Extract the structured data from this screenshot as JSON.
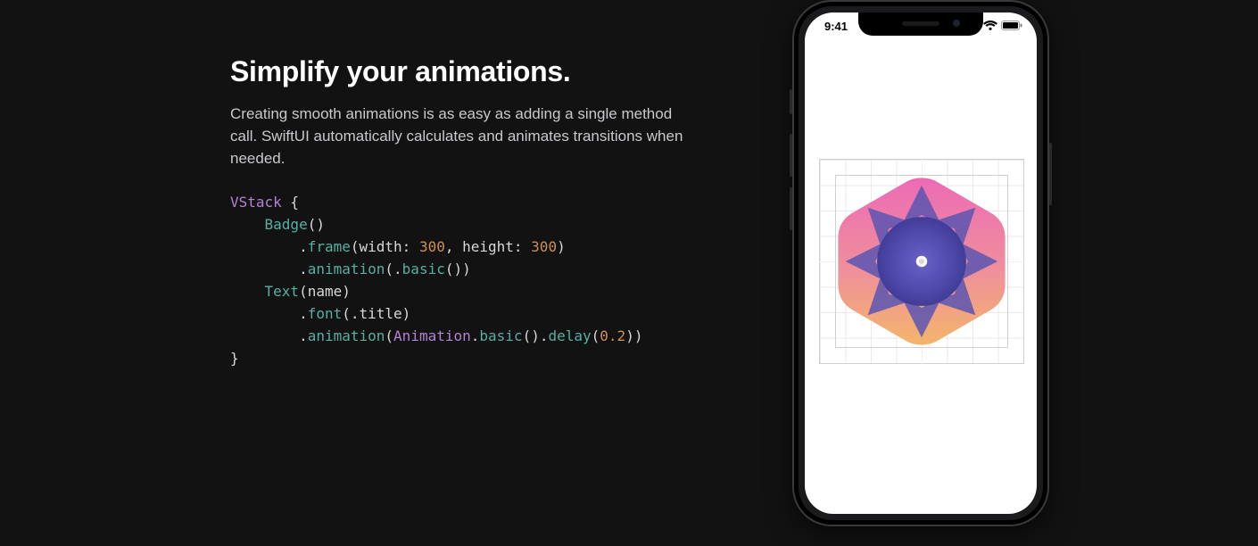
{
  "copy": {
    "heading": "Simplify your animations.",
    "paragraph": "Creating smooth animations is as easy as adding a single method call. SwiftUI automatically calculates and animates transitions when needed."
  },
  "code": {
    "tokens": [
      {
        "c": "kw",
        "t": "VStack"
      },
      {
        "c": "pn",
        "t": " {"
      },
      {
        "c": "br"
      },
      {
        "c": "pn",
        "t": "    "
      },
      {
        "c": "id",
        "t": "Badge"
      },
      {
        "c": "pn",
        "t": "()"
      },
      {
        "c": "br"
      },
      {
        "c": "pn",
        "t": "        ."
      },
      {
        "c": "id",
        "t": "frame"
      },
      {
        "c": "pn",
        "t": "(width: "
      },
      {
        "c": "lit",
        "t": "300"
      },
      {
        "c": "pn",
        "t": ", height: "
      },
      {
        "c": "lit",
        "t": "300"
      },
      {
        "c": "pn",
        "t": ")"
      },
      {
        "c": "br"
      },
      {
        "c": "pn",
        "t": "        ."
      },
      {
        "c": "id",
        "t": "animation"
      },
      {
        "c": "pn",
        "t": "(."
      },
      {
        "c": "id",
        "t": "basic"
      },
      {
        "c": "pn",
        "t": "())"
      },
      {
        "c": "br"
      },
      {
        "c": "pn",
        "t": "    "
      },
      {
        "c": "id",
        "t": "Text"
      },
      {
        "c": "pn",
        "t": "(name)"
      },
      {
        "c": "br"
      },
      {
        "c": "pn",
        "t": "        ."
      },
      {
        "c": "id",
        "t": "font"
      },
      {
        "c": "pn",
        "t": "(.title)"
      },
      {
        "c": "br"
      },
      {
        "c": "pn",
        "t": "        ."
      },
      {
        "c": "id",
        "t": "animation"
      },
      {
        "c": "pn",
        "t": "("
      },
      {
        "c": "kw",
        "t": "Animation"
      },
      {
        "c": "pn",
        "t": "."
      },
      {
        "c": "id",
        "t": "basic"
      },
      {
        "c": "pn",
        "t": "()."
      },
      {
        "c": "id",
        "t": "delay"
      },
      {
        "c": "pn",
        "t": "("
      },
      {
        "c": "lit",
        "t": "0.2"
      },
      {
        "c": "pn",
        "t": "))"
      },
      {
        "c": "br"
      },
      {
        "c": "pn",
        "t": "}"
      }
    ]
  },
  "phone": {
    "status": {
      "time": "9:41"
    }
  }
}
